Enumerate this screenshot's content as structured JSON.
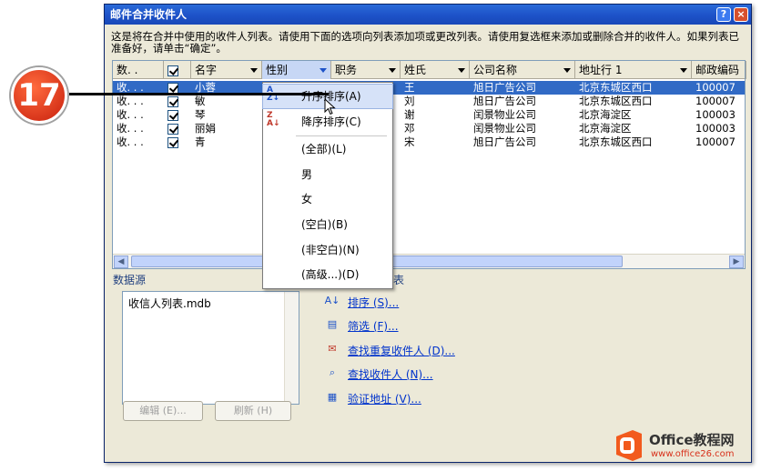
{
  "window": {
    "title": "邮件合并收件人",
    "help_label": "?",
    "close_label": "×"
  },
  "intro_text": "这是将在合并中使用的收件人列表。请使用下面的选项向列表添加项或更改列表。请使用复选框来添加或删除合并的收件人。如果列表已准备好，请单击“确定”。",
  "columns": [
    "数. .",
    "",
    "名字",
    "性别",
    "职务",
    "姓氏",
    "公司名称",
    "地址行 1",
    "邮政编码"
  ],
  "rows": [
    {
      "src": "收. . .",
      "name": "小蓉",
      "surname": "王",
      "company": "旭日广告公司",
      "address": "北京东城区西口",
      "zip": "100007",
      "selected": true
    },
    {
      "src": "收. . .",
      "name": "敏",
      "surname": "刘",
      "company": "旭日广告公司",
      "address": "北京东城区西口",
      "zip": "100007",
      "selected": false
    },
    {
      "src": "收. . .",
      "name": "琴",
      "surname": "谢",
      "company": "闰景物业公司",
      "address": "北京海淀区",
      "zip": "100003",
      "selected": false
    },
    {
      "src": "收. . .",
      "name": "丽娟",
      "surname": "邓",
      "company": "闰景物业公司",
      "address": "北京海淀区",
      "zip": "100003",
      "selected": false
    },
    {
      "src": "收. . .",
      "name": "青",
      "surname": "宋",
      "company": "旭日广告公司",
      "address": "北京东城区西口",
      "zip": "100007",
      "selected": false
    }
  ],
  "dropdown": {
    "items": [
      "升序排序(A)",
      "降序排序(C)",
      "(全部)(L)",
      "男",
      "女",
      "(空白)(B)",
      "(非空白)(N)",
      "(高级...)(D)"
    ]
  },
  "datasource": {
    "label": "数据源",
    "file": "收信人列表.mdb",
    "edit_button": "编辑 (E)...",
    "refresh_button": "刷新 (H)"
  },
  "adjust": {
    "label": "表",
    "links": [
      "排序 (S)...",
      "筛选 (F)...",
      "查找重复收件人 (D)...",
      "查找收件人 (N)...",
      "验证地址 (V)..."
    ]
  },
  "step_number": "17",
  "watermark": {
    "line1": "Office教程网",
    "line2": "www.office26.com"
  },
  "colors": {
    "title_bar": "#1d52c8",
    "selection": "#316ac5",
    "link": "#0033cc",
    "callout": "#d8301a",
    "watermark_orange": "#f25a1d"
  }
}
